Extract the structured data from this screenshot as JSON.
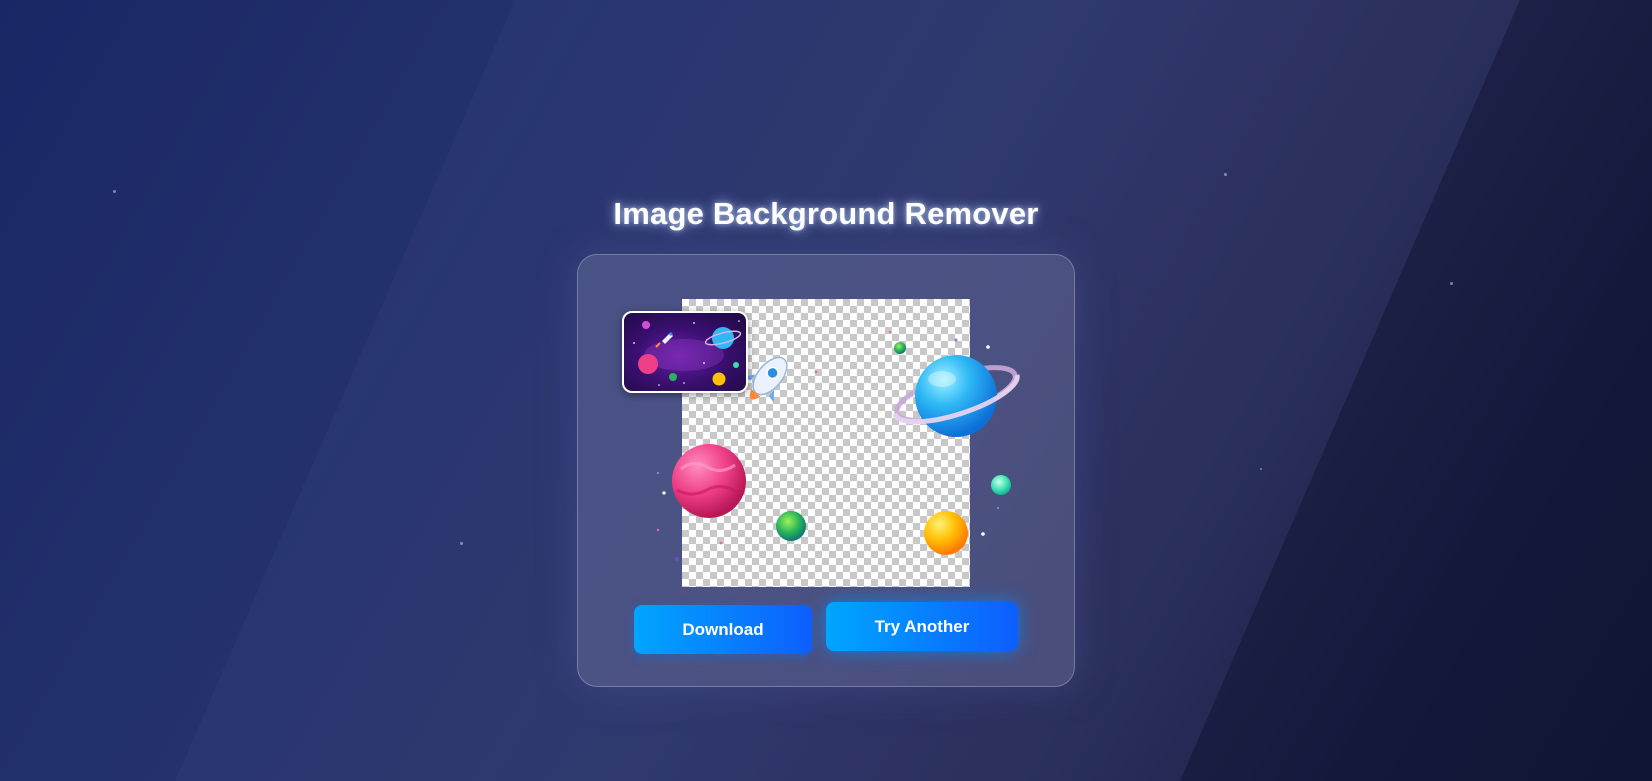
{
  "app": {
    "title": "Image Background Remover"
  },
  "buttons": {
    "download_label": "Download",
    "try_another_label": "Try Another"
  },
  "colors": {
    "accent_start": "#00a6ff",
    "accent_end": "#0d5eff",
    "background_dark": "#101533",
    "background_mid": "#22306b"
  },
  "images": {
    "original_thumbnail": "space-scene-thumbnail",
    "result_preview": "planets-transparent-background"
  }
}
